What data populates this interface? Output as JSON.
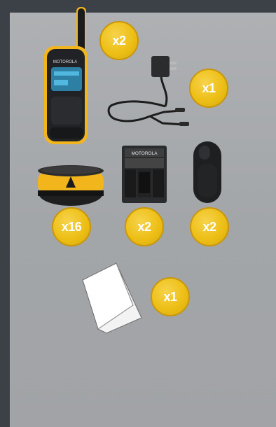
{
  "items": [
    {
      "name": "two-way-radio",
      "quantity_label": "x2"
    },
    {
      "name": "charger-with-splitter-cable",
      "quantity_label": "x1"
    },
    {
      "name": "battery-pack",
      "quantity_label": "x16"
    },
    {
      "name": "battery-holder",
      "quantity_label": "x2"
    },
    {
      "name": "belt-clip",
      "quantity_label": "x2"
    },
    {
      "name": "user-guide",
      "quantity_label": "x1"
    }
  ],
  "colors": {
    "background": "#3c4148",
    "panel": "#a7a9ac",
    "badge": "#edbf16",
    "accent_yellow": "#f2b51c"
  },
  "icons": [
    "radio-icon",
    "charger-icon",
    "battery-icon",
    "battery-holder-icon",
    "belt-clip-icon",
    "manual-icon"
  ]
}
